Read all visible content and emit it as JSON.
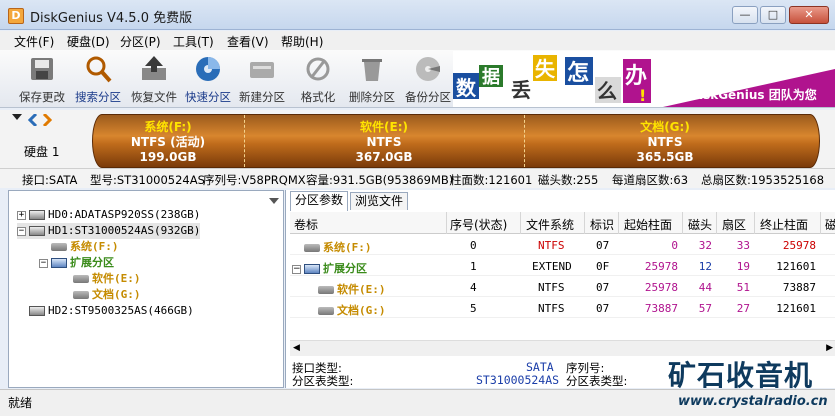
{
  "window": {
    "title": "DiskGenius V4.5.0 免费版",
    "minimize": "—",
    "maximize": "□",
    "close": "✕"
  },
  "menu": [
    "文件(F)",
    "硬盘(D)",
    "分区(P)",
    "工具(T)",
    "查看(V)",
    "帮助(H)"
  ],
  "toolbar": [
    {
      "label": "保存更改",
      "icon": "save-icon"
    },
    {
      "label": "搜索分区",
      "icon": "search-icon"
    },
    {
      "label": "恢复文件",
      "icon": "restore-icon"
    },
    {
      "label": "快速分区",
      "icon": "quick-partition-icon"
    },
    {
      "label": "新建分区",
      "icon": "new-partition-icon"
    },
    {
      "label": "格式化",
      "icon": "format-icon"
    },
    {
      "label": "删除分区",
      "icon": "delete-icon"
    },
    {
      "label": "备份分区",
      "icon": "backup-icon"
    }
  ],
  "banner": {
    "chars": [
      "数",
      "据",
      "丢",
      "失",
      "怎",
      "么",
      "办",
      "!"
    ],
    "text": "DiskGenius 团队为您"
  },
  "disk_panel": {
    "label": "硬盘 1",
    "segments": [
      {
        "name": "系统(F:)",
        "status": "(活动)",
        "fs": "NTFS",
        "size": "199.0GB"
      },
      {
        "name": "软件(E:)",
        "fs": "NTFS",
        "size": "367.0GB"
      },
      {
        "name": "文档(G:)",
        "fs": "NTFS",
        "size": "365.5GB"
      }
    ]
  },
  "disk_info": {
    "interface": "接口:SATA",
    "model": "型号:ST31000524AS",
    "serial": "序列号:V58PRQMX",
    "capacity": "容量:931.5GB(953869MB)",
    "cylinders": "柱面数:121601",
    "heads": "磁头数:255",
    "sectors_per_track": "每道扇区数:63",
    "total_sectors": "总扇区数:1953525168"
  },
  "tree": [
    {
      "text": "HD0:ADATASP920SS(238GB)",
      "expander": "+"
    },
    {
      "text": "HD1:ST31000524AS(932GB)",
      "expander": "−"
    },
    {
      "text": "系统(F:)"
    },
    {
      "text": "扩展分区",
      "expander": "−"
    },
    {
      "text": "软件(E:)"
    },
    {
      "text": "文档(G:)"
    },
    {
      "text": "HD2:ST9500325AS(466GB)",
      "expander": "+"
    }
  ],
  "tabs": [
    "分区参数",
    "浏览文件"
  ],
  "columns": [
    "卷标",
    "序号(状态)",
    "文件系统",
    "标识",
    "起始柱面",
    "磁头",
    "扇区",
    "终止柱面",
    "磁"
  ],
  "rows": [
    {
      "label": "系统(F:)",
      "index": "0",
      "fs": "NTFS",
      "id": "07",
      "start_cyl": "0",
      "head": "32",
      "sector": "33",
      "end_cyl": "25978"
    },
    {
      "label": "扩展分区",
      "index": "1",
      "fs": "EXTEND",
      "id": "0F",
      "start_cyl": "25978",
      "head": "12",
      "sector": "19",
      "end_cyl": "121601"
    },
    {
      "label": "软件(E:)",
      "index": "4",
      "fs": "NTFS",
      "id": "07",
      "start_cyl": "25978",
      "head": "44",
      "sector": "51",
      "end_cyl": "73887"
    },
    {
      "label": "文档(G:)",
      "index": "5",
      "fs": "NTFS",
      "id": "07",
      "start_cyl": "73887",
      "head": "57",
      "sector": "27",
      "end_cyl": "121601"
    }
  ],
  "details": {
    "iface_label": "接口类型:",
    "iface_value": "SATA",
    "serial_label": "序列号:",
    "model_value": "ST31000524AS",
    "parttable_label": "分区表类型:"
  },
  "status": "就绪",
  "watermark": {
    "cn": "矿石收音机",
    "url": "www.crystalradio.cn"
  },
  "colors": {
    "accent": "#2a5db0",
    "partition_bar": "#c06c1c",
    "highlight": "#ffe400",
    "extend_green": "#3a8b1a",
    "volume_orange": "#c58b00"
  }
}
